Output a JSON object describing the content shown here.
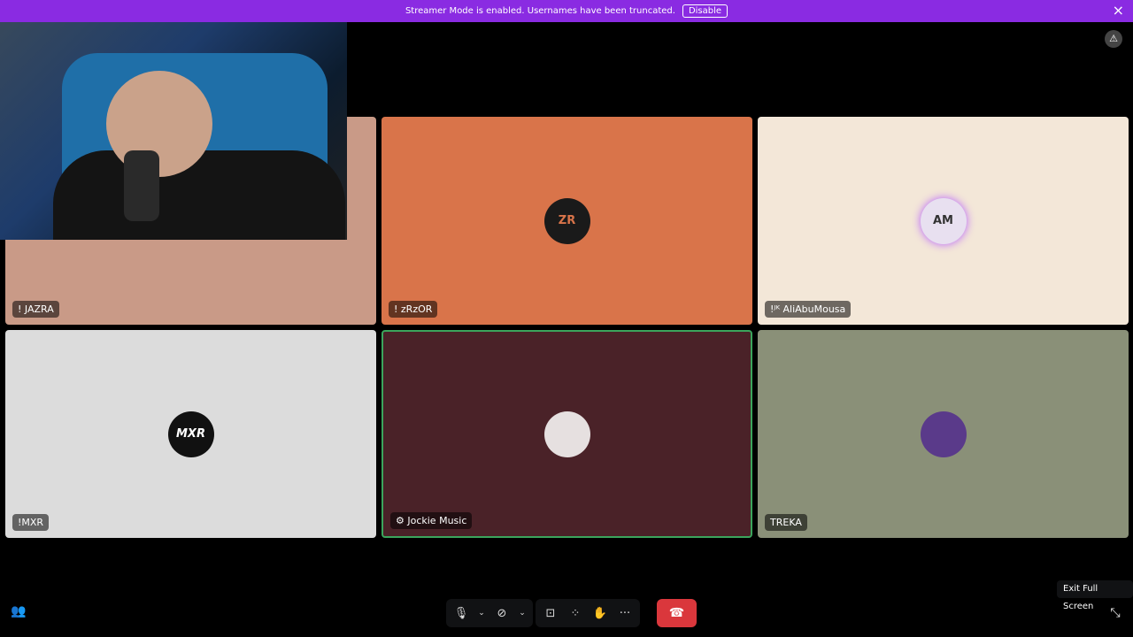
{
  "banner": {
    "message": "Streamer Mode is enabled. Usernames have been truncated.",
    "disable_label": "Disable",
    "close_icon": "×"
  },
  "tiles": [
    {
      "name": "! JAZRA",
      "bg": "#c99a87",
      "avatar": "",
      "avatar_bg": "#ccc"
    },
    {
      "name": "! zRzOR",
      "bg": "#d9744a",
      "avatar": "ZR",
      "avatar_bg": "#1a1a1a"
    },
    {
      "name": "!ᴶᴷ AliAbuMousa",
      "bg": "#f3e7d8",
      "avatar": "AM",
      "avatar_bg": "#e8e0f0"
    },
    {
      "name": "!MXR",
      "bg": "#dcdcdc",
      "avatar": "MXR",
      "avatar_bg": "#111"
    },
    {
      "name": "Jockie Music",
      "bg": "#4a2228",
      "avatar": "",
      "avatar_bg": "#e6e0e0"
    },
    {
      "name": "TREKA",
      "bg": "#8a9078",
      "avatar": "",
      "avatar_bg": "#5a3a8a"
    }
  ],
  "toolbar": {
    "mic_icon": "🎙",
    "camera_off_icon": "⊘",
    "chevron_icon": "⌄",
    "screen_share_icon": "⊡",
    "activities_icon": "⁘",
    "soundboard_icon": "✋",
    "more_icon": "···",
    "leave_icon": "☎"
  },
  "tooltip": "Exit Full Screen",
  "colors": {
    "banner": "#8a2be2",
    "leave": "#da373c",
    "speaking_border": "#3ba55c"
  }
}
